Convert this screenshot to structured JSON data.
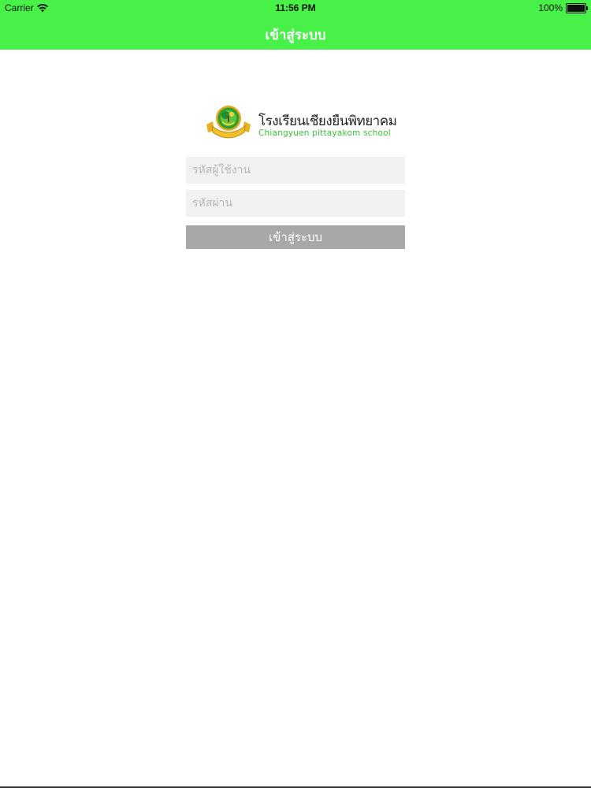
{
  "status_bar": {
    "carrier": "Carrier",
    "time": "11:56 PM",
    "battery_text": "100%",
    "battery_level": 1.0,
    "wifi_icon": "wifi-icon",
    "battery_icon": "battery-icon"
  },
  "nav": {
    "title": "เข้าสู่ระบบ"
  },
  "logo": {
    "thai_name": "โรงเรียนเชียงยืนพิทยาคม",
    "english_name": "Chiangyuen pittayakom school",
    "emblem_icon": "school-emblem-icon",
    "name_color": "#222222",
    "english_color": "#3ac23a"
  },
  "form": {
    "username_placeholder": "รหัสผู้ใช้งาน",
    "password_placeholder": "รหัสผ่าน",
    "login_label": "เข้าสู่ระบบ"
  },
  "colors": {
    "nav_bar": "#47f147",
    "field_background": "#f1f1f3",
    "button_background": "#a8a8a8"
  }
}
